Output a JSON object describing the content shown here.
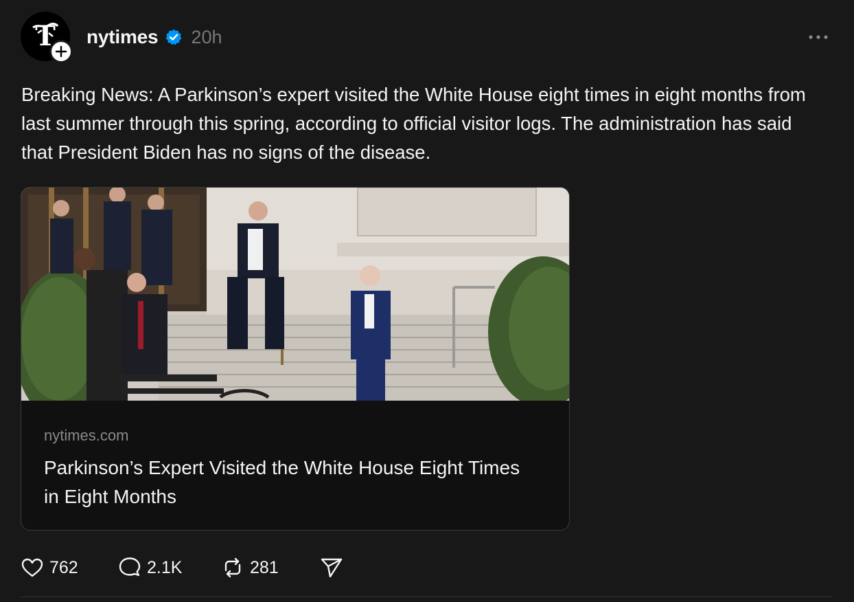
{
  "post": {
    "username": "nytimes",
    "time": "20h",
    "verified": true,
    "text": "Breaking News: A Parkinson’s expert visited the White House eight times in eight months from last summer through this spring, according to official visitor logs. The administration has said that President Biden has no signs of the disease."
  },
  "card": {
    "domain": "nytimes.com",
    "title": "Parkinson’s Expert Visited the White House Eight Times in Eight Months"
  },
  "actions": {
    "likes": "762",
    "replies": "2.1K",
    "reposts": "281"
  },
  "icons": {
    "avatar": "nyt-logo-icon",
    "follow": "plus-icon",
    "verified": "verified-badge-icon",
    "more": "more-options-icon",
    "like": "heart-icon",
    "reply": "comment-icon",
    "repost": "repost-icon",
    "share": "send-icon"
  },
  "colors": {
    "background": "#181818",
    "text": "#f3f5f7",
    "muted": "#777777",
    "verified": "#0095f6"
  }
}
